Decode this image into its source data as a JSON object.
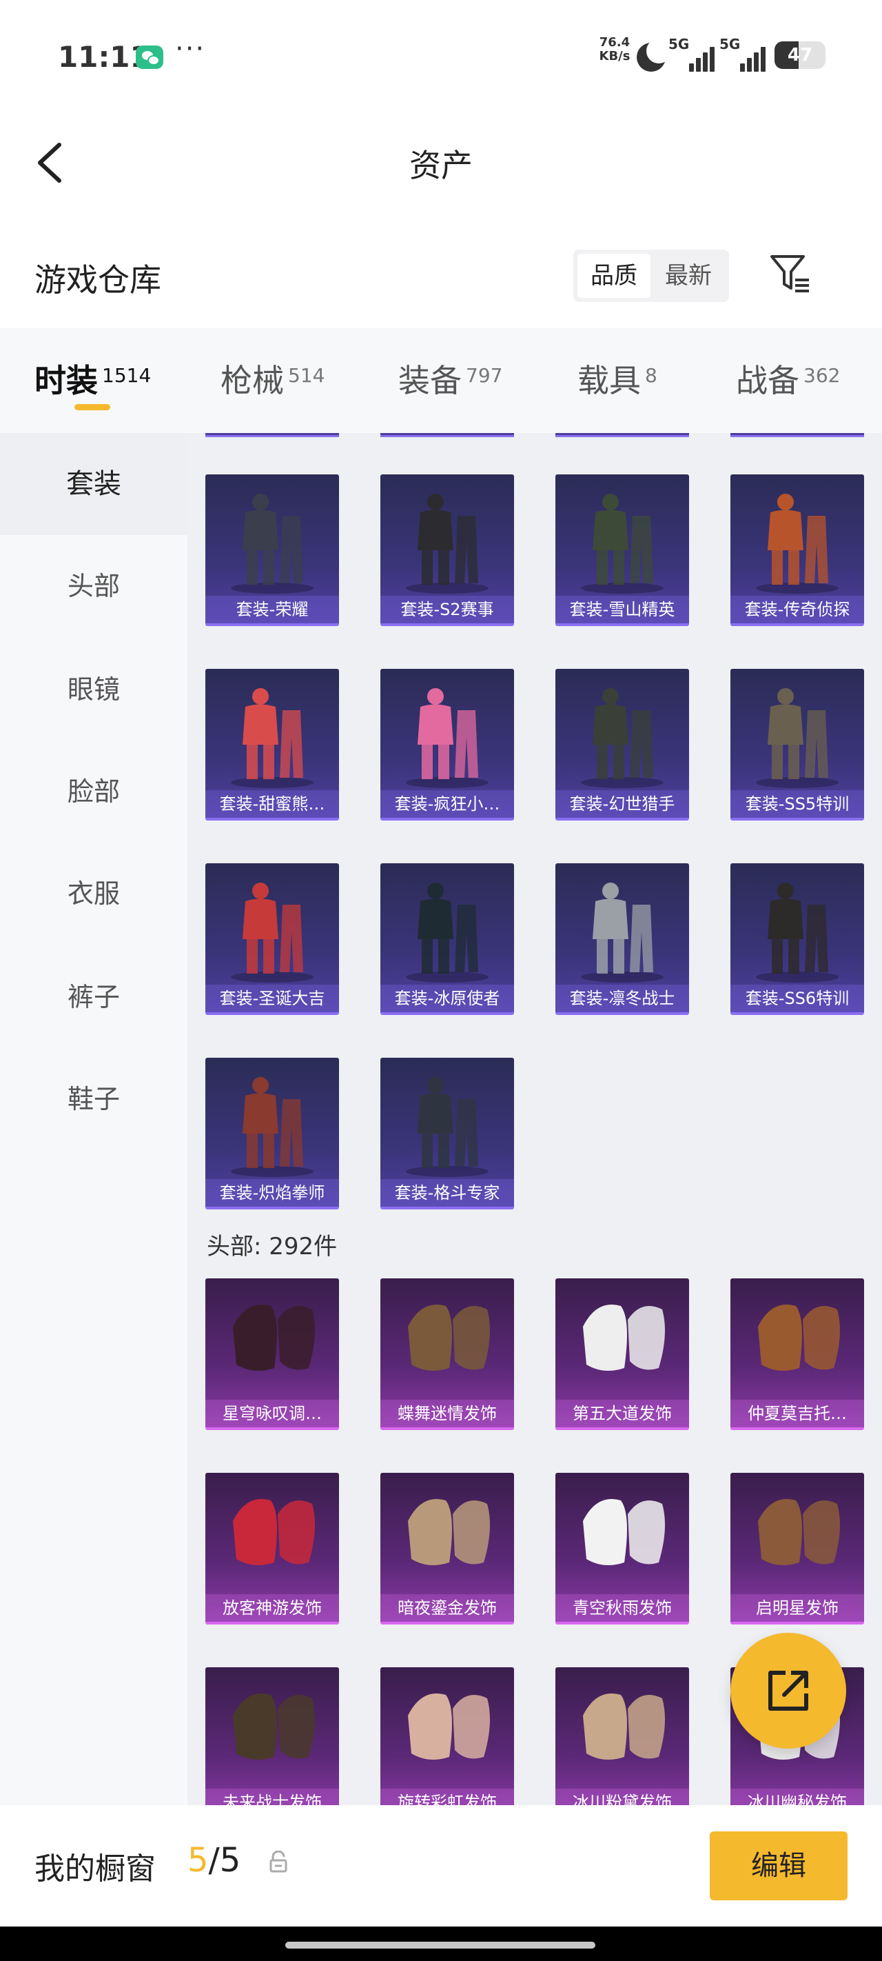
{
  "status_bar": {
    "time": "11:11",
    "net_speed_value": "76.4",
    "net_speed_unit": "KB/s",
    "signal_1_label": "5G",
    "signal_2_label": "5G",
    "battery_level": "47",
    "battery_fraction": 0.47,
    "icons": [
      "wechat-icon",
      "more-dots",
      "moon-icon",
      "signal-icon",
      "signal-icon",
      "battery-icon"
    ]
  },
  "header": {
    "title": "资产",
    "back_icon": "chevron-left-icon"
  },
  "warehouse": {
    "title": "游戏仓库",
    "sort_options": [
      "品质",
      "最新"
    ],
    "selected_sort": "品质",
    "filter_icon": "filter-icon"
  },
  "categories": [
    {
      "name": "时装",
      "count": "1514",
      "active": true
    },
    {
      "name": "枪械",
      "count": "514",
      "active": false
    },
    {
      "name": "装备",
      "count": "797",
      "active": false
    },
    {
      "name": "载具",
      "count": "8",
      "active": false
    },
    {
      "name": "战备",
      "count": "362",
      "active": false
    }
  ],
  "sidebar": {
    "items": [
      "套装",
      "头部",
      "眼镜",
      "脸部",
      "衣服",
      "裤子",
      "鞋子"
    ],
    "active": "套装"
  },
  "suits": [
    "套装-荣耀",
    "套装-S2赛事",
    "套装-雪山精英",
    "套装-传奇侦探",
    "套装-甜蜜熊…",
    "套装-疯狂小…",
    "套装-幻世猎手",
    "套装-SS5特训",
    "套装-圣诞大吉",
    "套装-冰原使者",
    "套装-凛冬战士",
    "套装-SS6特训",
    "套装-炽焰拳师",
    "套装-格斗专家"
  ],
  "head_section": {
    "title": "头部: 292件",
    "items": [
      "星穹咏叹调…",
      "蝶舞迷情发饰",
      "第五大道发饰",
      "仲夏莫吉托…",
      "放客神游发饰",
      "暗夜鎏金发饰",
      "青空秋雨发饰",
      "启明星发饰",
      "未来战士发饰",
      "旋转彩虹发饰",
      "冰川粉黛发饰",
      "冰川幽秘发饰"
    ]
  },
  "share_icon": "share-icon",
  "bottom_bar": {
    "showcase_label": "我的橱窗",
    "showcase_current": "5",
    "showcase_separator": "/",
    "showcase_total": "5",
    "lock_icon": "lock-icon",
    "edit_label": "编辑"
  },
  "colors": {
    "accent": "#f5b92e",
    "suit_card": "#3a3479",
    "head_card": "#5b2877",
    "sidebar_bg": "#f7f8fa",
    "content_bg": "#eef0f4"
  }
}
